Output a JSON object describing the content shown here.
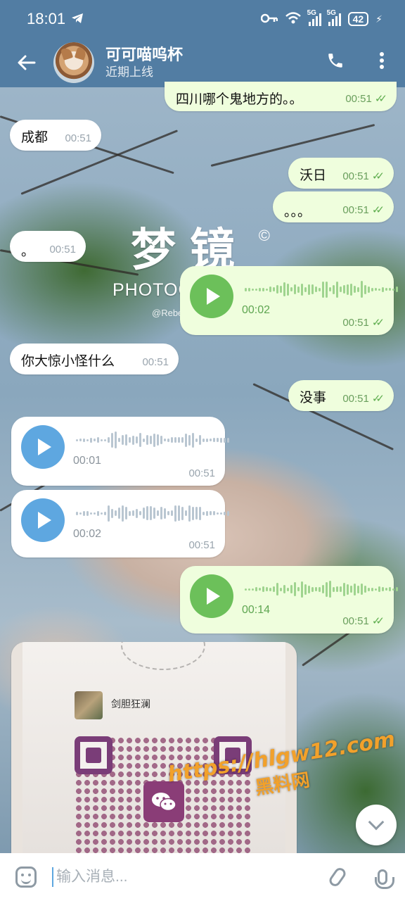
{
  "status_bar": {
    "time": "18:01",
    "network_left": "5G",
    "network_right": "5G",
    "battery": "42"
  },
  "header": {
    "title": "可可喵呜杯",
    "subtitle": "近期上线"
  },
  "watermark": {
    "title": "梦镜",
    "subtitle": "PHOTOGRAPHER",
    "handle": "@Rebee3366",
    "mark": "©"
  },
  "messages": [
    {
      "dir": "out",
      "type": "text",
      "text": "四川哪个鬼地方的。。",
      "time": "00:51",
      "read": true
    },
    {
      "dir": "in",
      "type": "text",
      "text": "成都",
      "time": "00:51"
    },
    {
      "dir": "out",
      "type": "text",
      "text": "沃日",
      "time": "00:51",
      "read": true
    },
    {
      "dir": "out",
      "type": "text",
      "text": "。。。",
      "time": "00:51",
      "read": true
    },
    {
      "dir": "in",
      "type": "text",
      "text": "。",
      "time": "00:51"
    },
    {
      "dir": "out",
      "type": "voice",
      "duration": "00:02",
      "time": "00:51",
      "read": true
    },
    {
      "dir": "in",
      "type": "text",
      "text": "你大惊小怪什么",
      "time": "00:51"
    },
    {
      "dir": "out",
      "type": "text",
      "text": "没事",
      "time": "00:51",
      "read": true
    },
    {
      "dir": "in",
      "type": "voice",
      "duration": "00:01",
      "time": "00:51"
    },
    {
      "dir": "in",
      "type": "voice",
      "duration": "00:02",
      "time": "00:51"
    },
    {
      "dir": "out",
      "type": "voice",
      "duration": "00:14",
      "time": "00:51",
      "read": true
    }
  ],
  "photo": {
    "qr_owner_name": "剑胆狂澜"
  },
  "overlay": {
    "url": "https://hlgw12.com",
    "site_name": "黑料网"
  },
  "input": {
    "placeholder": "输入消息..."
  },
  "colors": {
    "header": "#527da3",
    "outgoing_bubble": "#effedd",
    "incoming_bubble": "#ffffff",
    "play_out": "#6cc05a",
    "play_in": "#5ea7e0",
    "overlay_text": "#f2a12b"
  },
  "icons": {
    "back": "arrow-left-icon",
    "call": "phone-icon",
    "menu": "more-vertical-icon",
    "emoji": "emoji-icon",
    "attach": "paperclip-icon",
    "mic": "microphone-icon",
    "scroll": "chevron-down-icon"
  }
}
